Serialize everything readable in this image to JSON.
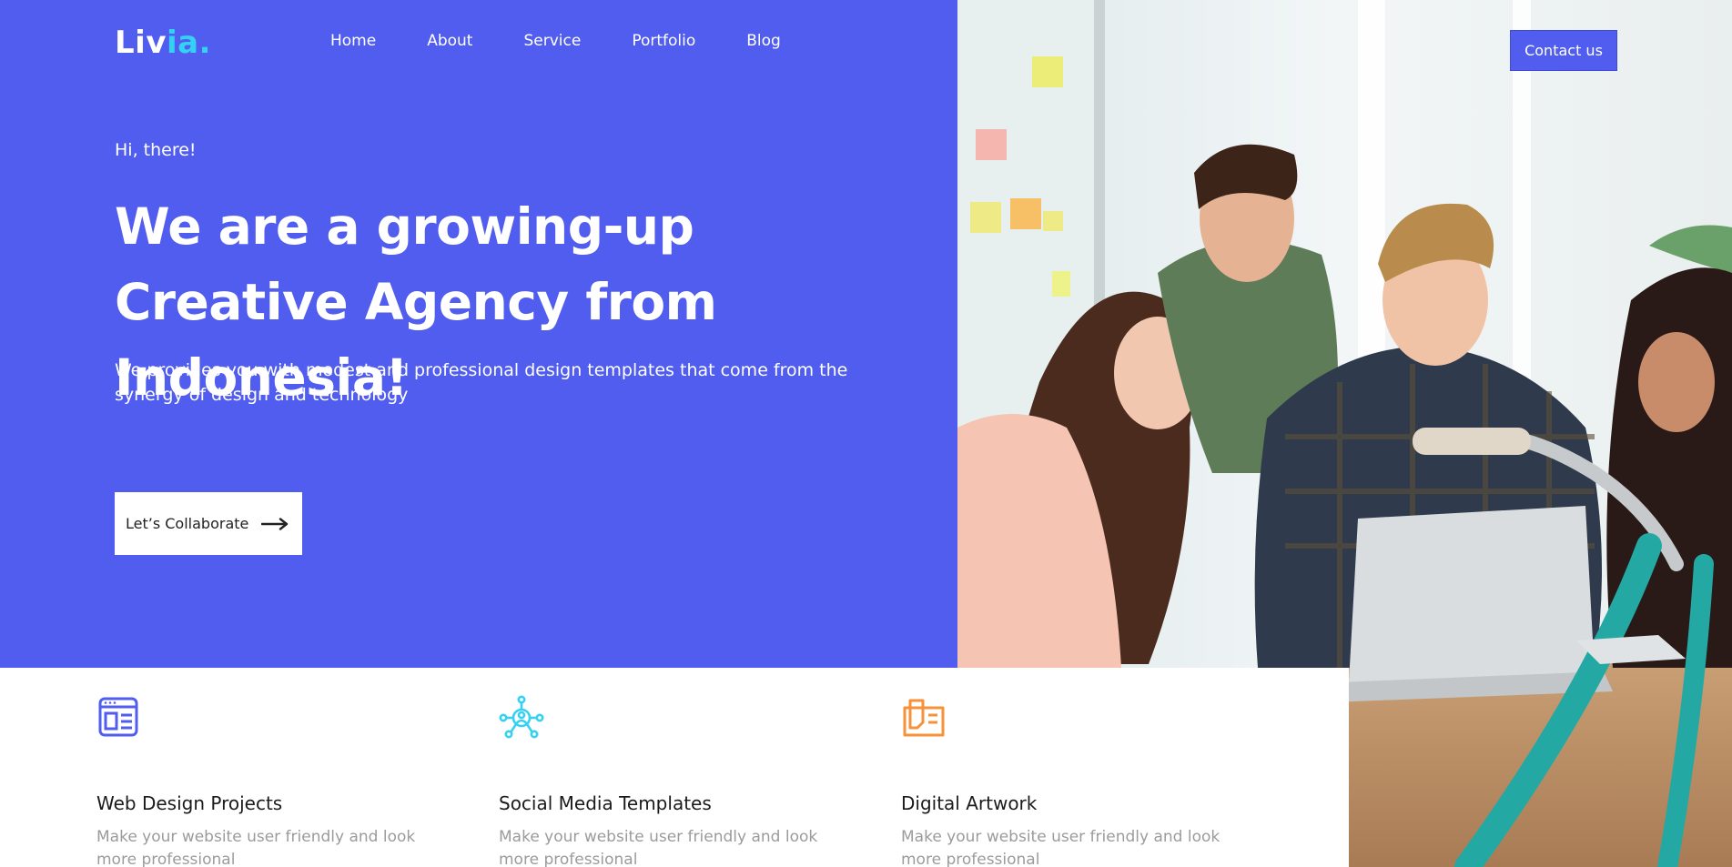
{
  "brand": {
    "logo_part1": "Liv",
    "logo_part2": "ia",
    "logo_part3": "."
  },
  "nav": {
    "items": [
      {
        "label": "Home"
      },
      {
        "label": "About"
      },
      {
        "label": "Service"
      },
      {
        "label": "Portfolio"
      },
      {
        "label": "Blog"
      }
    ]
  },
  "header": {
    "contact_label": "Contact us"
  },
  "hero": {
    "greeting": "Hi, there!",
    "headline": "We are a growing-up Creative Agency from Indonesia!",
    "subtext": "We provides you with modest and professional design templates that come from the synergy of design and technology",
    "cta_label": "Let’s Collaborate"
  },
  "features": [
    {
      "icon": "web-design-icon",
      "title": "Web Design Projects",
      "description": "Make your website user friendly and look more professional"
    },
    {
      "icon": "social-network-icon",
      "title": "Social Media Templates",
      "description": "Make your website user friendly and look more professional"
    },
    {
      "icon": "digital-artwork-icon",
      "title": "Digital Artwork",
      "description": "Make your website user friendly and look more professional"
    }
  ],
  "colors": {
    "primary": "#505DEE",
    "accent_cyan": "#35D1F5",
    "accent_orange": "#F7923A",
    "text_dark": "#1b1b1b",
    "text_muted": "#9b9b9b"
  }
}
